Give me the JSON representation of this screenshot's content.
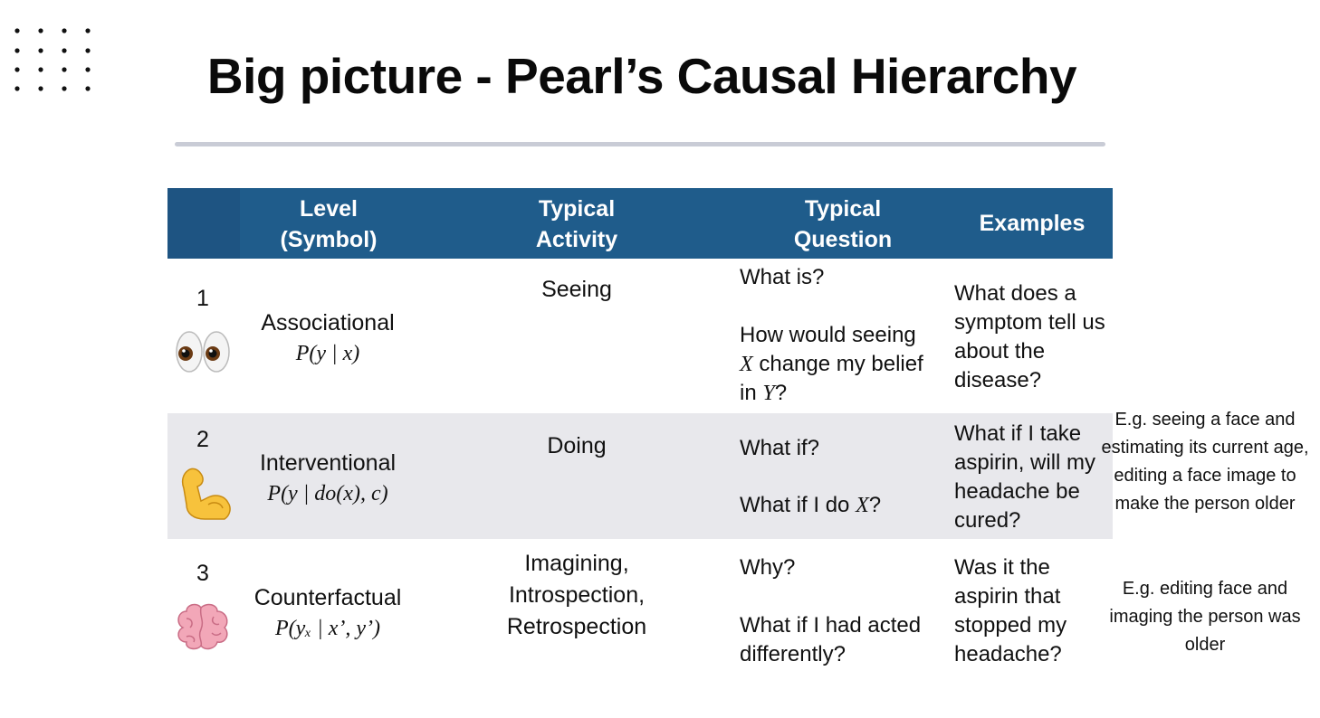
{
  "slide": {
    "title": "Big picture - Pearl’s Causal Hierarchy"
  },
  "table": {
    "headers": {
      "level": "Level\n(Symbol)",
      "activity": "Typical\nActivity",
      "question": "Typical\nQuestion",
      "examples": "Examples"
    },
    "rows": [
      {
        "number": "1",
        "icon": "eyes-icon",
        "level": "Associational",
        "symbol": "P(y | x)",
        "activity": "Seeing",
        "question_1": "What is?",
        "question_2_pre": "How would seeing",
        "question_2_var1": "X",
        "question_2_mid": " change my belief",
        "question_2_line3_pre": "in ",
        "question_2_var2": "Y",
        "question_2_post": "?",
        "example": "What does a symptom tell us about the disease?"
      },
      {
        "number": "2",
        "icon": "flexed-biceps-icon",
        "level": "Interventional",
        "symbol": "P(y | do(x), c)",
        "activity": "Doing",
        "question_1": "What if?",
        "question_2_pre": "What if I do ",
        "question_2_var1": "X",
        "question_2_post": "?",
        "example": "What if I take aspirin, will my headache be cured?"
      },
      {
        "number": "3",
        "icon": "brain-icon",
        "level": "Counterfactual",
        "symbol": "P(yₓ | x’, y’)",
        "activity": "Imagining,\nIntrospection,\nRetrospection",
        "question_1": "Why?",
        "question_2": "What if I had acted differently?",
        "example": "Was it the aspirin that stopped my headache?"
      }
    ]
  },
  "notes": {
    "interventional": "E.g. seeing a face and estimating its current age,\nediting a face image to make the person older",
    "counterfactual": "E.g. editing face and imaging the person was older"
  },
  "colors": {
    "header_bg": "#1f5c8b",
    "row2_bg": "#e8e8ec",
    "rule": "#c9ccd6"
  }
}
